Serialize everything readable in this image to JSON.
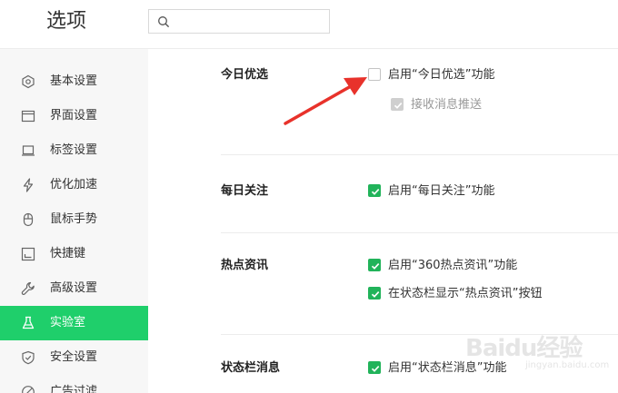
{
  "header": {
    "title": "选项",
    "search": {
      "value": "",
      "placeholder": ""
    }
  },
  "sidebar": {
    "items": [
      {
        "label": "基本设置",
        "icon": "settings-hexagon-icon",
        "active": false
      },
      {
        "label": "界面设置",
        "icon": "window-icon",
        "active": false
      },
      {
        "label": "标签设置",
        "icon": "tab-icon",
        "active": false
      },
      {
        "label": "优化加速",
        "icon": "lightning-icon",
        "active": false
      },
      {
        "label": "鼠标手势",
        "icon": "mouse-icon",
        "active": false
      },
      {
        "label": "快捷键",
        "icon": "keyboard-icon",
        "active": false
      },
      {
        "label": "高级设置",
        "icon": "wrench-icon",
        "active": false
      },
      {
        "label": "实验室",
        "icon": "flask-icon",
        "active": true
      },
      {
        "label": "安全设置",
        "icon": "shield-icon",
        "active": false
      },
      {
        "label": "广告过滤",
        "icon": "block-icon",
        "active": false
      }
    ]
  },
  "sections": [
    {
      "title": "今日优选",
      "options": [
        {
          "label": "启用“今日优选”功能",
          "checked": false,
          "disabled": false
        },
        {
          "label": "接收消息推送",
          "checked": true,
          "disabled": true
        }
      ]
    },
    {
      "title": "每日关注",
      "options": [
        {
          "label": "启用“每日关注”功能",
          "checked": true,
          "disabled": false
        }
      ]
    },
    {
      "title": "热点资讯",
      "options": [
        {
          "label": "启用“360热点资讯”功能",
          "checked": true,
          "disabled": false
        },
        {
          "label": "在状态栏显示“热点资讯”按钮",
          "checked": true,
          "disabled": false
        }
      ]
    },
    {
      "title": "状态栏消息",
      "options": [
        {
          "label": "启用“状态栏消息”功能",
          "checked": true,
          "disabled": false
        }
      ]
    }
  ],
  "colors": {
    "accent": "#1fcf6b",
    "checkbox_on": "#21b35a",
    "arrow": "#e8322b"
  },
  "watermark": {
    "text": "Baidu经验",
    "sub": "jingyan.baidu.com"
  }
}
